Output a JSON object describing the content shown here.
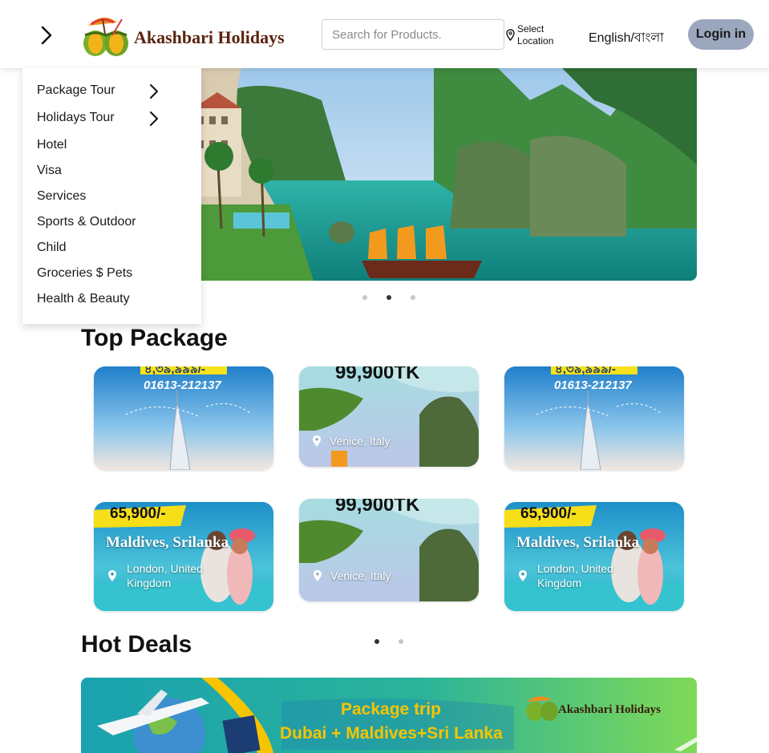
{
  "header": {
    "brand_name": "Akashbari Holidays",
    "search_placeholder": "Search for Products.",
    "location_line1": "Select",
    "location_line2": "Location",
    "language": "English/বাংলা",
    "login_label": "Login in"
  },
  "menu": {
    "items": [
      {
        "label": "Package Tour",
        "has_submenu": true
      },
      {
        "label": "Holidays Tour",
        "has_submenu": true
      },
      {
        "label": "Hotel",
        "has_submenu": false
      },
      {
        "label": "Visa",
        "has_submenu": false
      },
      {
        "label": "Services",
        "has_submenu": false
      },
      {
        "label": "Sports & Outdoor",
        "has_submenu": false
      },
      {
        "label": "Child",
        "has_submenu": false
      },
      {
        "label": "Groceries $ Pets",
        "has_submenu": false
      },
      {
        "label": "Health & Beauty",
        "has_submenu": false
      }
    ]
  },
  "hero": {
    "slide_count": 3,
    "active_slide": 2
  },
  "top_package": {
    "title": "Top Package",
    "cards": [
      {
        "price": "৪,৩৯,৯৯৯/-",
        "phone": "01613-212137"
      },
      {
        "price": "99,900TK",
        "location": "Venice, Italy"
      },
      {
        "price": "৪,৩৯,৯৯৯/-",
        "phone": "01613-212137"
      },
      {
        "price": "65,900/-",
        "destination": "Maldives, Srilanka",
        "location": "London, United Kingdom"
      },
      {
        "price": "99,900TK",
        "location": "Venice, Italy"
      },
      {
        "price": "65,900/-",
        "destination": "Maldives, Srilanka",
        "location": "London, United Kingdom"
      }
    ],
    "page_count": 2,
    "active_page": 1
  },
  "hot_deals": {
    "title": "Hot Deals",
    "banner_line1": "Package trip",
    "banner_line2": "Dubai + Maldives+Sri Lanka",
    "banner_brand": "Akashbari Holidays"
  },
  "colors": {
    "login_bg": "#9aa7bd",
    "brand_text": "#5a2410",
    "banner_text": "#f6c500"
  }
}
